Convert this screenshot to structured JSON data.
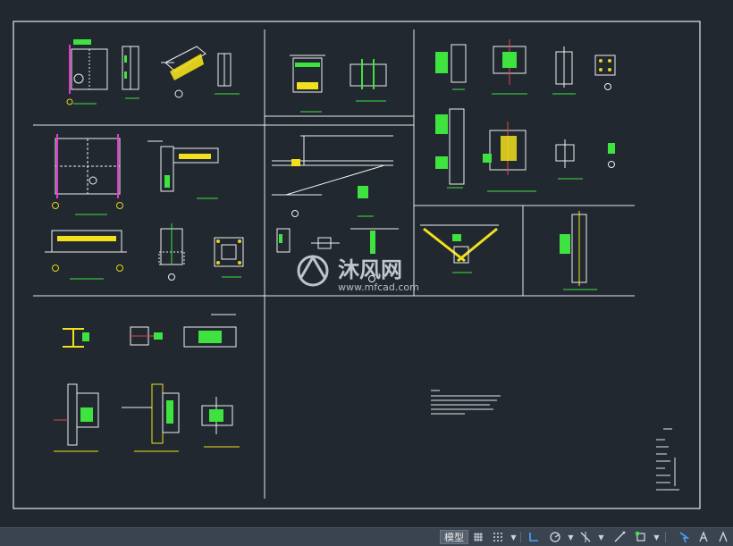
{
  "watermark": {
    "brand": "沐风网",
    "url": "www.mfcad.com"
  },
  "drawing": {
    "colors": {
      "background": "#212830",
      "frame": "#e8e8e8",
      "steel": "#f0f0f0",
      "dim": "#3fe33f",
      "plate": "#f2e01c",
      "bolt": "#e8d31a",
      "marker": "#e33ad2",
      "cyan": "#5ad7e0",
      "red": "#e84545"
    }
  },
  "statusbar": {
    "model_tab": "模型",
    "icons": [
      "grid-icon",
      "snap-icon",
      "ortho-icon",
      "polar-icon",
      "osnap-track-icon",
      "isodraft-icon",
      "dynamic-ucs-icon",
      "selection-icon",
      "annotation-scale-icon",
      "workspace-icon"
    ]
  }
}
